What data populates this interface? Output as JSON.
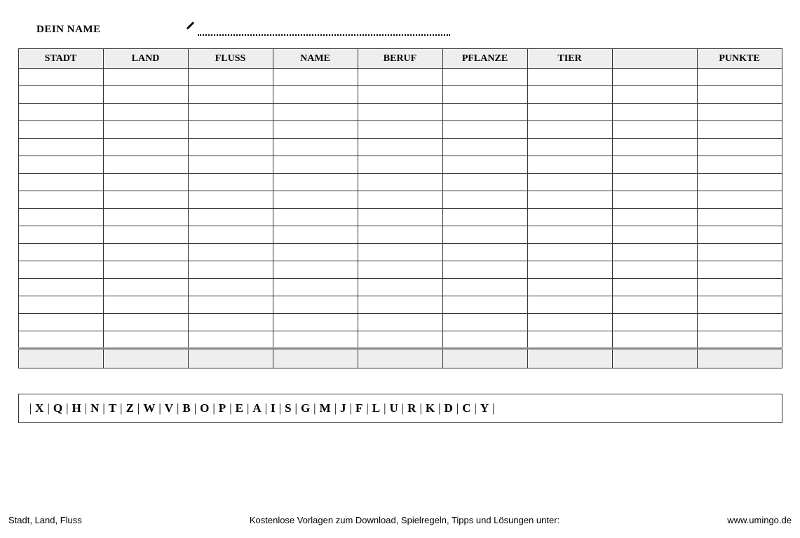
{
  "header": {
    "name_label": "DEIN NAME",
    "name_value": ""
  },
  "table": {
    "columns": [
      "STADT",
      "LAND",
      "FLUSS",
      "NAME",
      "BERUF",
      "PFLANZE",
      "TIER",
      "",
      "PUNKTE"
    ],
    "row_count": 16
  },
  "letters": [
    "X",
    "Q",
    "H",
    "N",
    "T",
    "Z",
    "W",
    "V",
    "B",
    "O",
    "P",
    "E",
    "A",
    "I",
    "S",
    "G",
    "M",
    "J",
    "F",
    "L",
    "U",
    "R",
    "K",
    "D",
    "C",
    "Y"
  ],
  "footer": {
    "left": "Stadt, Land, Fluss",
    "center": "Kostenlose Vorlagen zum Download, Spielregeln, Tipps und Lösungen unter:",
    "right": "www.umingo.de"
  }
}
